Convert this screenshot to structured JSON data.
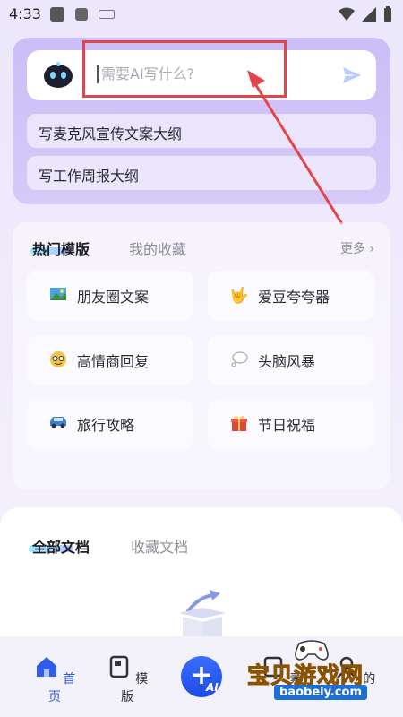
{
  "status_bar": {
    "time": "4:33"
  },
  "ai_writer": {
    "placeholder": "需要AI写什么?",
    "suggestions": [
      "写麦克风宣传文案大纲",
      "写工作周报大纲"
    ]
  },
  "templates": {
    "tabs": [
      "热门模版",
      "我的收藏"
    ],
    "more": "更多 ›",
    "items": [
      {
        "label": "朋友圈文案",
        "icon": "photo-icon"
      },
      {
        "label": "爱豆夸夸器",
        "icon": "rock-hand-icon"
      },
      {
        "label": "高情商回复",
        "icon": "smart-face-icon"
      },
      {
        "label": "头脑风暴",
        "icon": "thought-bubble-icon"
      },
      {
        "label": "旅行攻略",
        "icon": "car-icon"
      },
      {
        "label": "节日祝福",
        "icon": "gift-icon"
      }
    ]
  },
  "documents": {
    "tabs": [
      "全部文档",
      "收藏文档"
    ]
  },
  "bottom_nav": {
    "home": "首页",
    "templates": "模版",
    "fab_label": "AI",
    "materials": "素",
    "mine": "的"
  },
  "watermark": {
    "text": "宝贝游戏网",
    "url": "baobeiy.com"
  },
  "colors": {
    "accent": "#1d4ce6",
    "highlight": "#e2464c",
    "card_gradient": "#cbbdf7"
  }
}
